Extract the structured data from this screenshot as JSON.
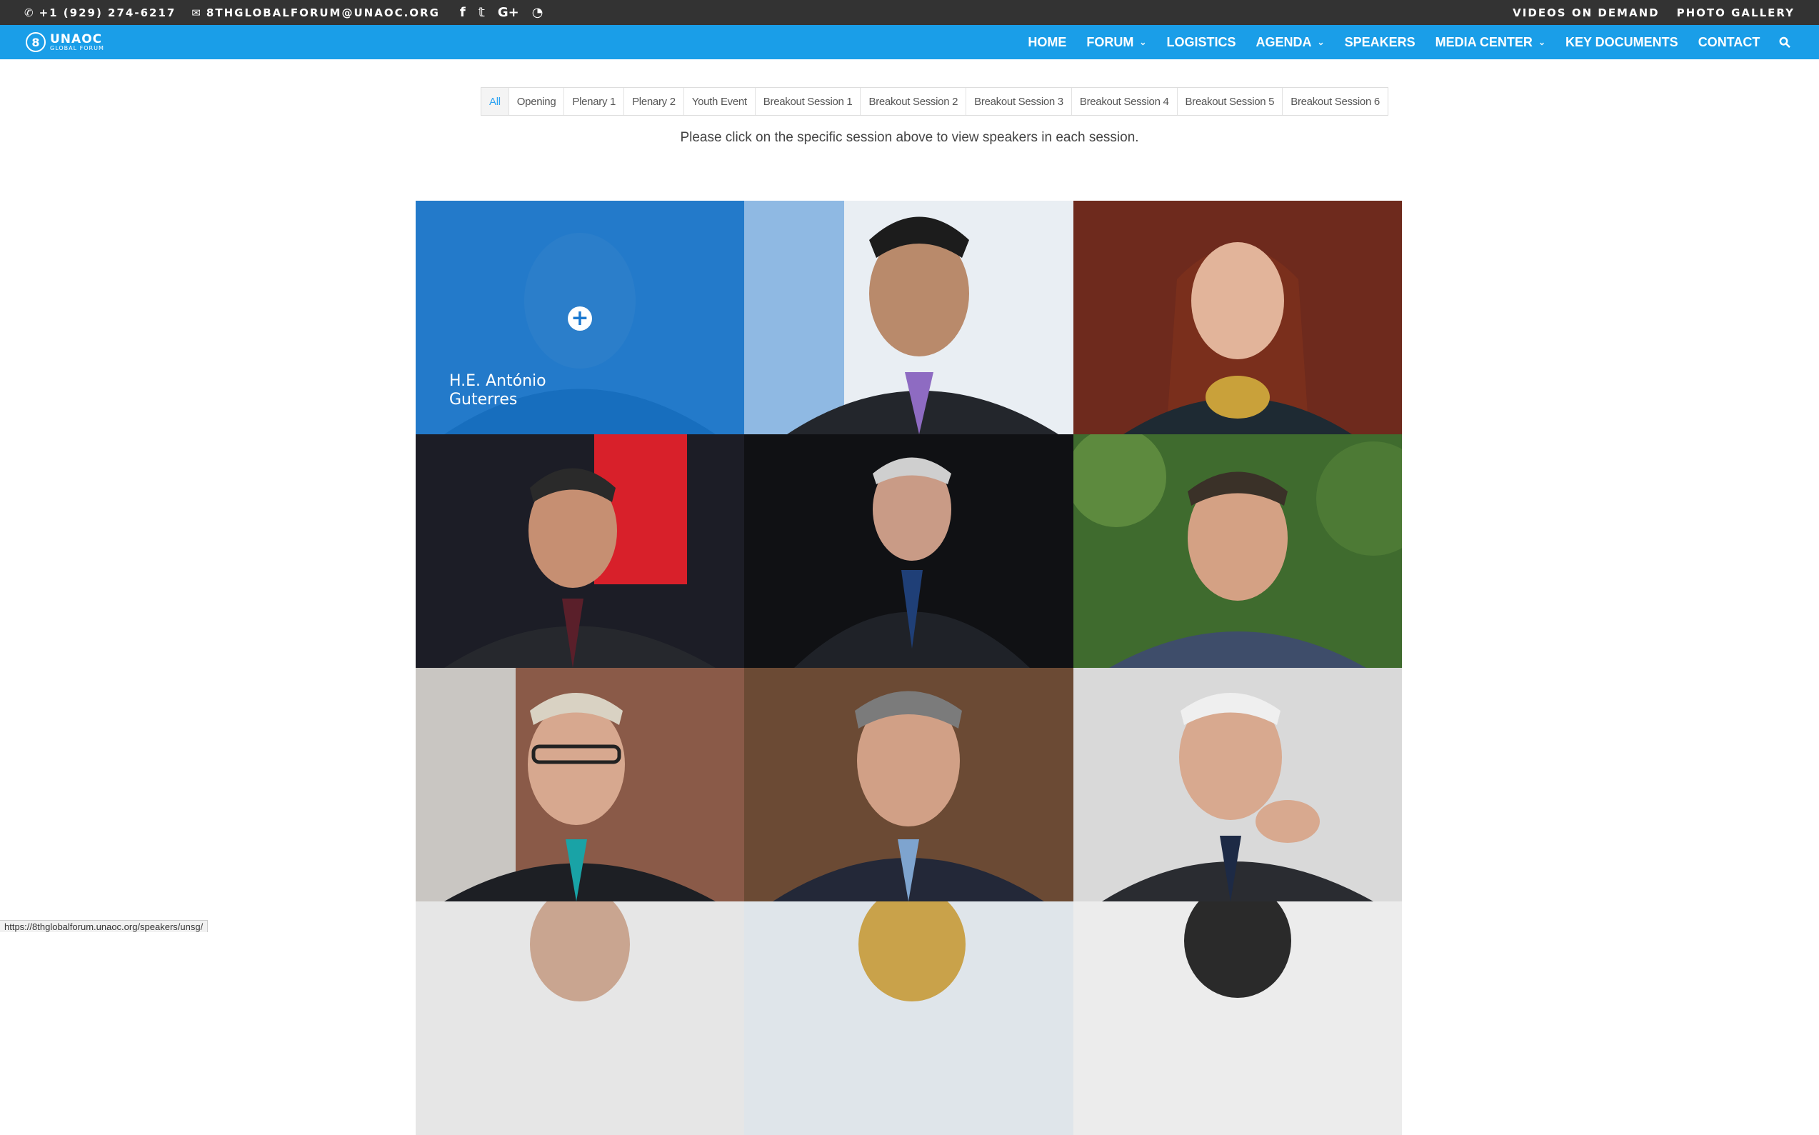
{
  "topbar": {
    "phone": "+1 (929) 274-6217",
    "email": "8THGLOBALFORUM@UNAOC.ORG",
    "social": [
      "facebook-icon",
      "twitter-icon",
      "google-plus-icon",
      "rss-icon"
    ],
    "links": [
      "VIDEOS ON DEMAND",
      "PHOTO GALLERY"
    ]
  },
  "nav": {
    "logo_primary": "UNAOC",
    "logo_secondary": "GLOBAL FORUM",
    "logo_badge": "8",
    "items": [
      {
        "label": "HOME",
        "dropdown": false
      },
      {
        "label": "FORUM",
        "dropdown": true
      },
      {
        "label": "LOGISTICS",
        "dropdown": false
      },
      {
        "label": "AGENDA",
        "dropdown": true
      },
      {
        "label": "SPEAKERS",
        "dropdown": false,
        "active": true
      },
      {
        "label": "MEDIA CENTER",
        "dropdown": true
      },
      {
        "label": "KEY DOCUMENTS",
        "dropdown": false
      },
      {
        "label": "CONTACT",
        "dropdown": false
      }
    ]
  },
  "filters": {
    "tabs": [
      "All",
      "Opening",
      "Plenary 1",
      "Plenary 2",
      "Youth Event",
      "Breakout Session 1",
      "Breakout Session 2",
      "Breakout Session 3",
      "Breakout Session 4",
      "Breakout Session 5",
      "Breakout Session 6"
    ],
    "active": "All"
  },
  "instruction": "Please click on the specific session above to view speakers in each session.",
  "speakers": {
    "hovered_name": "H.E. António Guterres",
    "hovered_name_line1": "H.E. António",
    "hovered_name_line2": "Guterres"
  },
  "status_url": "https://8thglobalforum.unaoc.org/speakers/unsg/",
  "colors": {
    "topbar": "#333333",
    "nav": "#1a9ee8",
    "accent": "#2ea3f2",
    "overlay": "#1578d2"
  }
}
